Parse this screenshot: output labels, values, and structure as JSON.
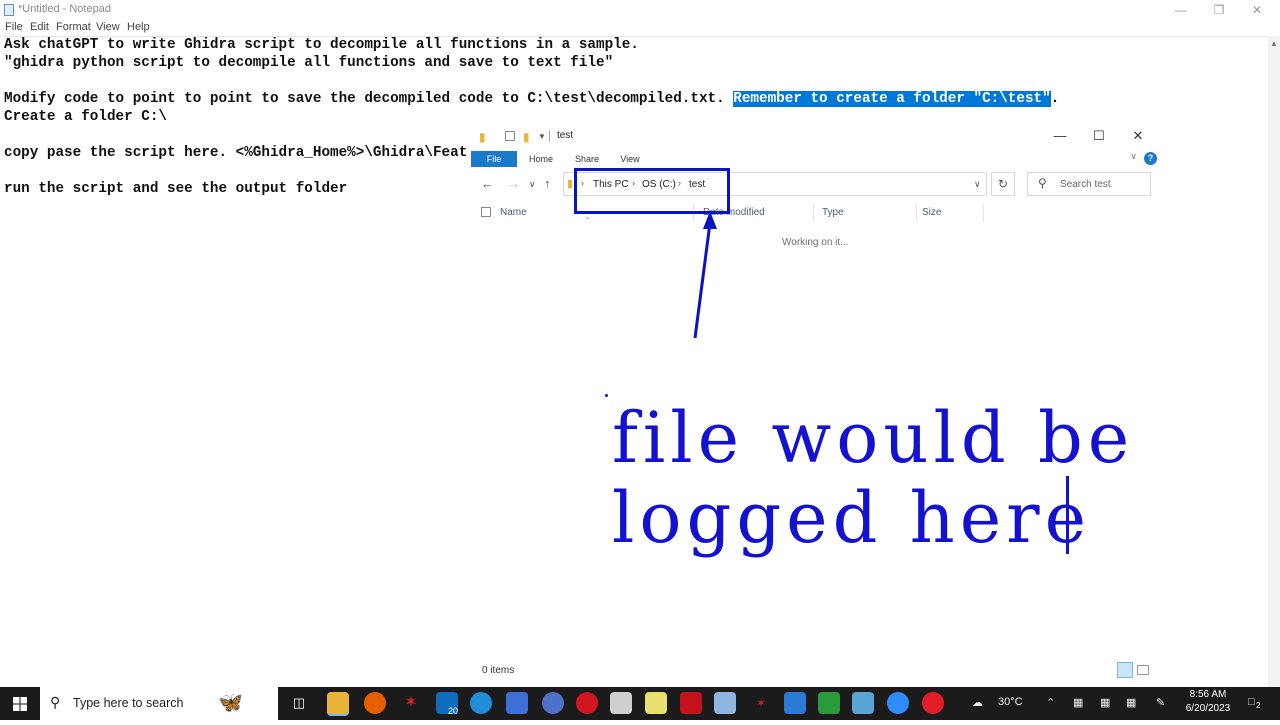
{
  "notepad": {
    "title": "*Untitled - Notepad",
    "menu": [
      "File",
      "Edit",
      "Format",
      "View",
      "Help"
    ],
    "lines": {
      "l1": "Ask chatGPT to write Ghidra script to decompile all functions in a sample.",
      "l2": "\"ghidra python script to decompile all functions and save to text file\"",
      "l3a": "Modify code to point to point to save the decompiled code to C:\\test\\decompiled.txt. ",
      "l3sel": "Remember to create a folder \"C:\\test\"",
      "l3b": ".",
      "l4": "Create a folder C:\\",
      "l5": "copy pase the script here. <%Ghidra_Home%>\\Ghidra\\Feat",
      "l6": "run the script and see the output folder"
    }
  },
  "explorer": {
    "title": "test",
    "tabs": [
      "File",
      "Home",
      "Share",
      "View"
    ],
    "breadcrumb": [
      "This PC",
      "OS (C:)",
      "test"
    ],
    "search_placeholder": "Search test",
    "columns": [
      "Name",
      "Date modified",
      "Type",
      "Size"
    ],
    "working_text": "Working on it...",
    "status": "0 items"
  },
  "annotation": {
    "line1": "file would be",
    "line2": "logged here",
    "color": "#1212d0"
  },
  "taskbar": {
    "search_placeholder": "Type here to search",
    "mail_badge": "20",
    "weather": "30°C",
    "time": "8:56 AM",
    "date": "6/20/2023",
    "notifications": "2"
  }
}
